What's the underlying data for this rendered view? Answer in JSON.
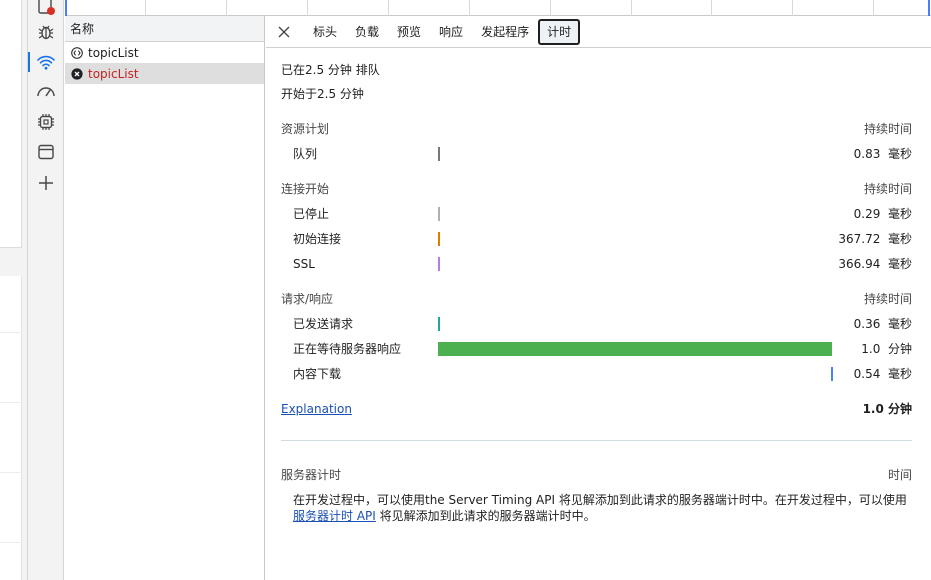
{
  "waterfall": {
    "gridline_count": 10
  },
  "request_list": {
    "column_header": "名称",
    "rows": [
      {
        "name": "topicList",
        "icon": "code-brackets-icon",
        "selected": false,
        "error": false
      },
      {
        "name": "topicList",
        "icon": "error-circle-icon",
        "selected": true,
        "error": true
      }
    ]
  },
  "tabs": [
    {
      "label": "标头",
      "active": false
    },
    {
      "label": "负载",
      "active": false
    },
    {
      "label": "预览",
      "active": false
    },
    {
      "label": "响应",
      "active": false
    },
    {
      "label": "发起程序",
      "active": false
    },
    {
      "label": "计时",
      "active": true
    }
  ],
  "timing": {
    "queued_at": "已在2.5 分钟 排队",
    "started_at": "开始于2.5 分钟",
    "sections": [
      {
        "title": "资源计划",
        "duration_header": "持续时间",
        "rows": [
          {
            "name": "队列",
            "value": "0.83",
            "unit": "毫秒",
            "bar_start": 0.0,
            "bar_width": 0.003,
            "color": "#777777"
          }
        ]
      },
      {
        "title": "连接开始",
        "duration_header": "持续时间",
        "rows": [
          {
            "name": "已停止",
            "value": "0.29",
            "unit": "毫秒",
            "bar_start": 0.0,
            "bar_width": 0.002,
            "color": "#b0b0b0"
          },
          {
            "name": "初始连接",
            "value": "367.72",
            "unit": "毫秒",
            "bar_start": 0.0,
            "bar_width": 0.004,
            "color": "#e07b00"
          },
          {
            "name": "SSL",
            "value": "366.94",
            "unit": "毫秒",
            "bar_start": 0.0,
            "bar_width": 0.004,
            "color": "#b57bea"
          }
        ]
      },
      {
        "title": "请求/响应",
        "duration_header": "持续时间",
        "rows": [
          {
            "name": "已发送请求",
            "value": "0.36",
            "unit": "毫秒",
            "bar_start": 0.0,
            "bar_width": 0.003,
            "color": "#26a69a"
          },
          {
            "name": "正在等待服务器响应",
            "value": "1.0",
            "unit": "分钟",
            "bar_start": 0.0,
            "bar_width": 1.0,
            "color": "#4caf50"
          },
          {
            "name": "内容下载",
            "value": "0.54",
            "unit": "毫秒",
            "bar_start": 0.998,
            "bar_width": 0.002,
            "color": "#4285f4"
          }
        ]
      }
    ],
    "explanation_link": "Explanation",
    "total": "1.0 分钟",
    "server_timing": {
      "title": "服务器计时",
      "time_header": "时间",
      "text_before": "在开发过程中，可以使用the Server Timing API 将见解添加到此请求的服务器端计时中。在开发过程中，可以使用",
      "link": "服务器计时 API",
      "text_after": " 将见解添加到此请求的服务器端计时中。"
    }
  }
}
